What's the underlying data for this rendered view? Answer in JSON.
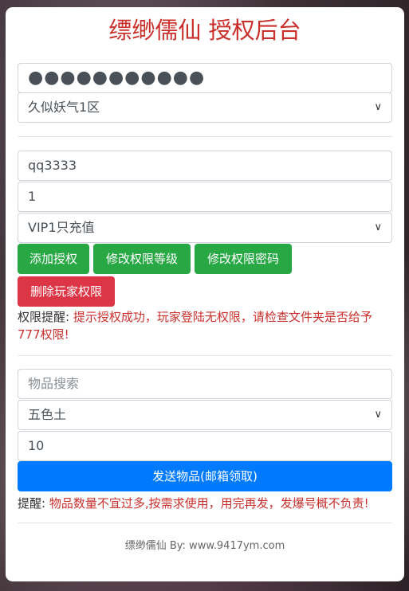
{
  "title": "缥缈儒仙 授权后台",
  "auth": {
    "password_value": "●●●●●●●●●●●",
    "server_select": "久似妖气1区"
  },
  "perm": {
    "account_value": "qq3333",
    "level_value": "1",
    "vip_select": "VIP1只充值",
    "buttons": {
      "add": "添加授权",
      "modify_level": "修改权限等级",
      "modify_password": "修改权限密码",
      "delete": "删除玩家权限"
    },
    "notice_label": "权限提醒:",
    "notice_text": "提示授权成功，玩家登陆无权限，请检查文件夹是否给予777权限!"
  },
  "items": {
    "search_placeholder": "物品搜索",
    "item_select": "五色土",
    "quantity_value": "10",
    "send_button": "发送物品(邮箱领取)",
    "notice_label": "提醒:",
    "notice_text": "物品数量不宜过多,按需求使用，用完再发，发爆号概不负责!"
  },
  "footer": "缥缈儒仙 By:  www.9417ym.com",
  "colors": {
    "title_red": "#c9302c",
    "green": "#28a745",
    "red": "#dc3545",
    "blue": "#007bff"
  }
}
